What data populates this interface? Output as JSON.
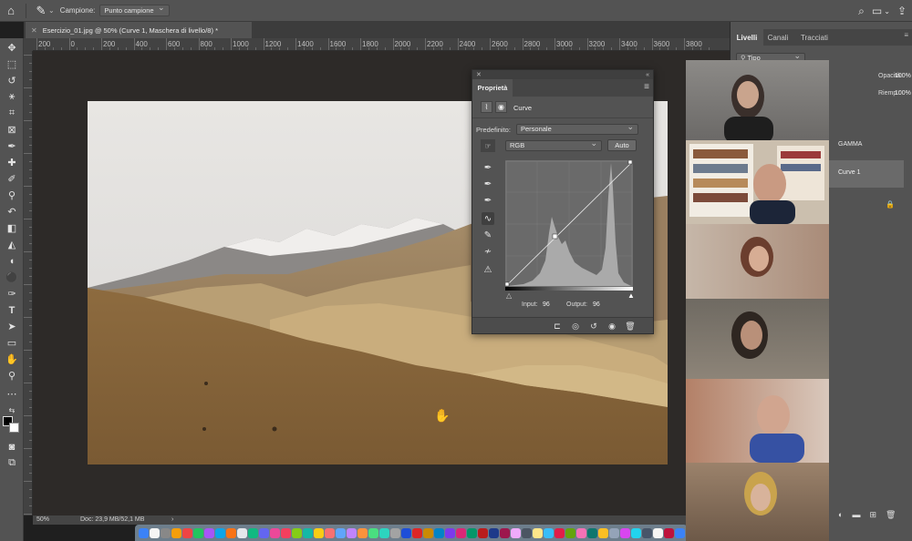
{
  "options_bar": {
    "sample_label": "Campione:",
    "sample_value": "Punto campione"
  },
  "document": {
    "tab_title": "Esercizio_01.jpg @ 50% (Curve 1, Maschera di livello/8) *"
  },
  "ruler": {
    "h_labels": [
      "200",
      "0",
      "200",
      "400",
      "600",
      "800",
      "1000",
      "1200",
      "1400",
      "1600",
      "1800",
      "2000",
      "2200",
      "2400",
      "2600",
      "2800",
      "3000",
      "3200",
      "3400",
      "3600",
      "3800"
    ]
  },
  "properties": {
    "tab_label": "Proprietà",
    "adjustment_name": "Curve",
    "preset_label": "Predefinito:",
    "preset_value": "Personale",
    "channel_value": "RGB",
    "auto_label": "Auto",
    "input_label": "Input:",
    "input_value": "96",
    "output_label": "Output:",
    "output_value": "96"
  },
  "right_panel": {
    "tabs": [
      "Livelli",
      "Canali",
      "Tracciati"
    ],
    "filter_value": "Tipo",
    "opacity_label": "Opacità:",
    "opacity_value": "100%",
    "fill_label": "Riemp.:",
    "fill_value": "100%",
    "layers": [
      "GAMMA",
      "Curve 1"
    ]
  },
  "status_bar": {
    "zoom": "50%",
    "doc_info": "Doc: 23,9 MB/52,1 MB",
    "arrow": "›"
  },
  "colors": {
    "panel_bg": "#535353",
    "canvas_bg": "#2d2a28",
    "accent_selected_layer": "#6a6a6a"
  }
}
